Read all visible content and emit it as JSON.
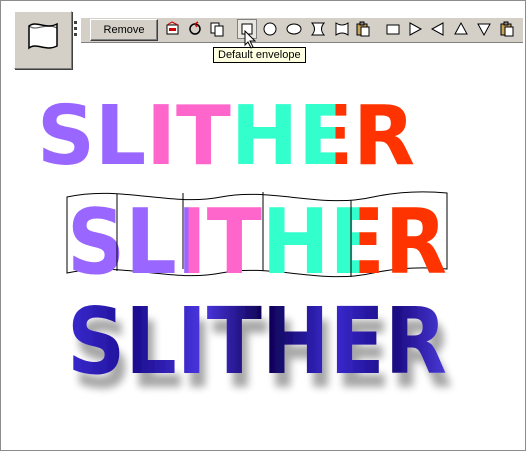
{
  "toolbar": {
    "remove_label": "Remove",
    "tool_icon": "envelope-flag-icon",
    "icons": [
      "envelope-edit-icon",
      "circular-arrow-icon",
      "copy-icon",
      "default-envelope-icon",
      "circle-envelope-icon",
      "ellipse-envelope-icon",
      "hourglass-envelope-icon",
      "bow-envelope-icon",
      "paste-icon",
      "rectangle-icon",
      "triangle-right-icon",
      "triangle-left-icon",
      "triangle-up-icon",
      "triangle-down-icon",
      "paste-icon"
    ],
    "pressed_icon": "default-envelope-icon"
  },
  "tooltip": {
    "text": "Default envelope"
  },
  "artwork": [
    {
      "text": "SLITHER",
      "style": "flat multicolor",
      "colors": [
        "#9966ff",
        "#9966ff",
        "#ff66cc",
        "#ff66cc",
        "#33ffcc",
        "#33ffcc",
        "#ff3300"
      ]
    },
    {
      "text": "SLITHER",
      "style": "wavy envelope",
      "colors": [
        "#9966ff",
        "#9966ff",
        "#ff66cc",
        "#ff66cc",
        "#33ffcc",
        "#33ffcc",
        "#ff3300"
      ]
    },
    {
      "text": "SLITHER",
      "style": "blue gradient with shadow",
      "colors": [
        "#2b1bb0",
        "#0a0060",
        "#4a3ad8"
      ]
    }
  ]
}
